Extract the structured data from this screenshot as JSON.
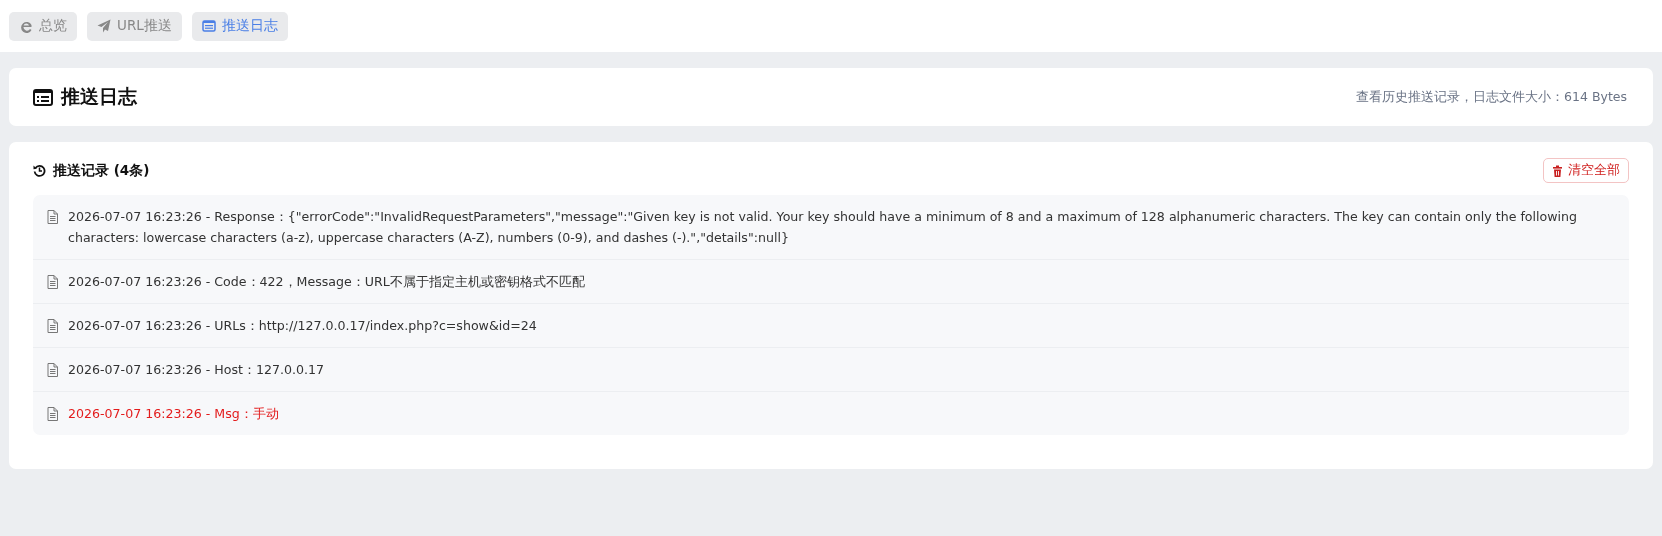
{
  "tabs": [
    {
      "label": "总览",
      "kind": "browser",
      "selected": false
    },
    {
      "label": "URL推送",
      "kind": "send",
      "selected": false
    },
    {
      "label": "推送日志",
      "kind": "log",
      "selected": true
    }
  ],
  "header": {
    "title": "推送日志",
    "subtitle": "查看历史推送记录，日志文件大小：614 Bytes"
  },
  "records": {
    "title": "推送记录 (4条)",
    "clear_button": "清空全部",
    "entries": [
      {
        "kind": "info",
        "text": "2026-07-07 16:23:26 - Response：{\"errorCode\":\"InvalidRequestParameters\",\"message\":\"Given key is not valid. Your key should have a minimum of 8 and a maximum of 128 alphanumeric characters. The key can contain only the following characters: lowercase characters (a-z), uppercase characters (A-Z), numbers (0-9), and dashes (-).\",\"details\":null}"
      },
      {
        "kind": "info",
        "text": "2026-07-07 16:23:26 - Code：422，Message：URL不属于指定主机或密钥格式不匹配"
      },
      {
        "kind": "info",
        "text": "2026-07-07 16:23:26 - URLs：http://127.0.0.17/index.php?c=show&id=24"
      },
      {
        "kind": "info",
        "text": "2026-07-07 16:23:26 - Host：127.0.0.17"
      },
      {
        "kind": "error",
        "text": "2026-07-07 16:23:26 - Msg：手动"
      }
    ]
  }
}
